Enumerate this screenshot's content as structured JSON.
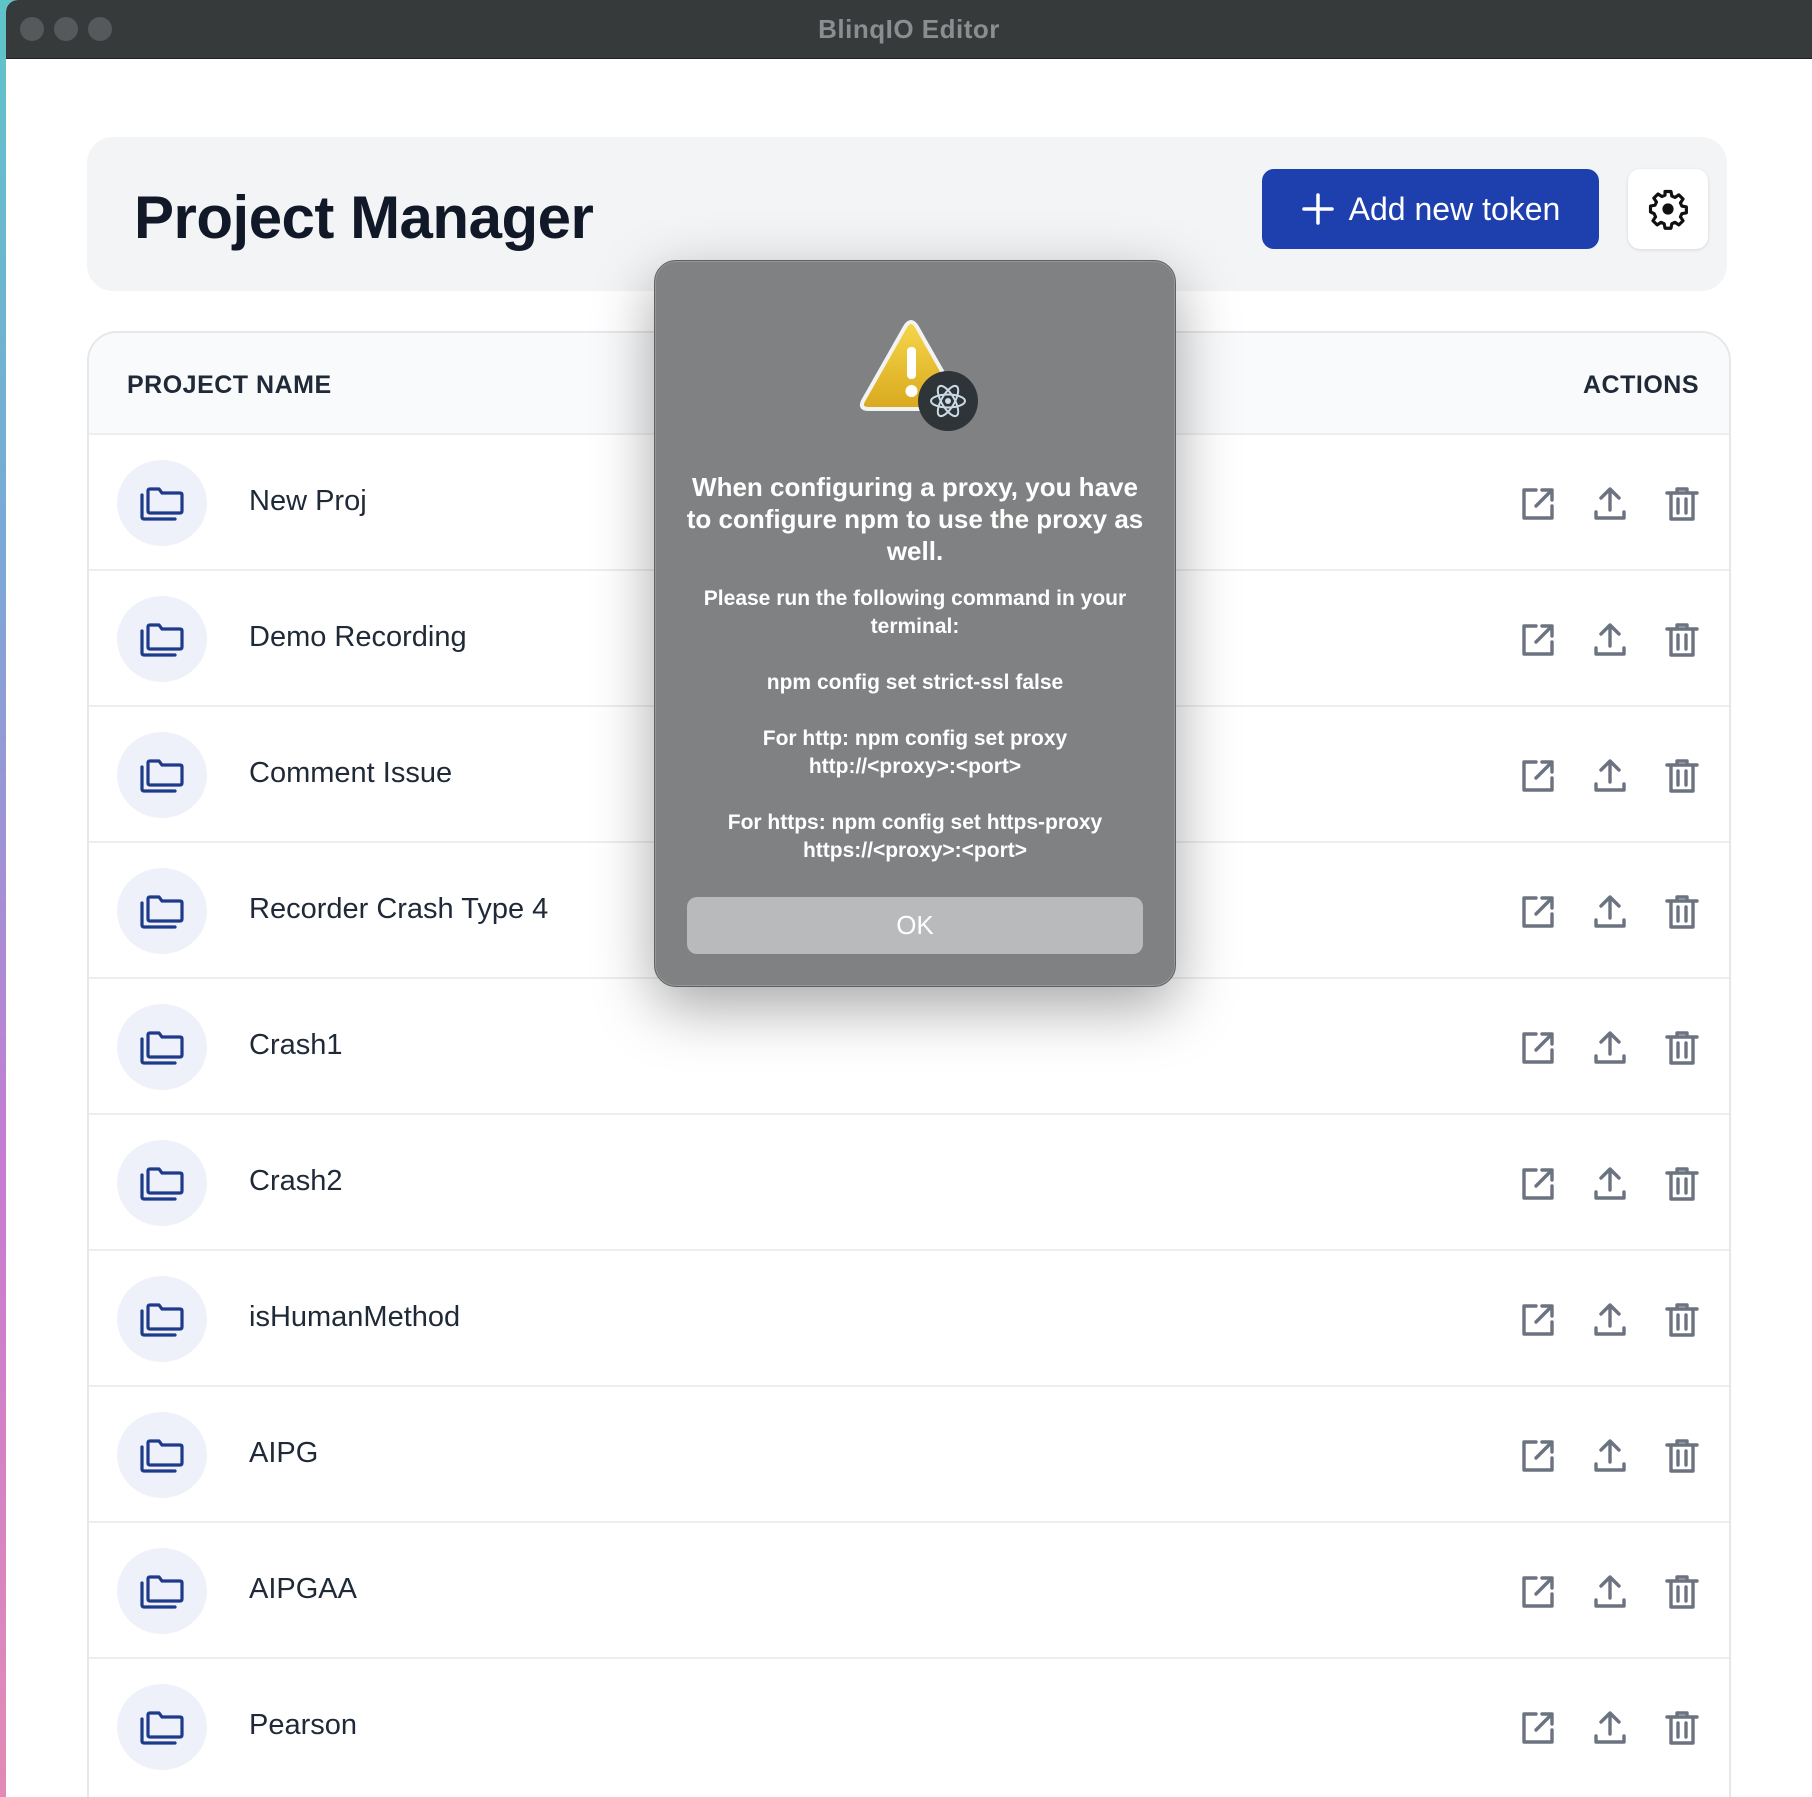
{
  "window": {
    "title": "BlinqIO Editor"
  },
  "header": {
    "title": "Project Manager",
    "add_token_label": "Add new token"
  },
  "table": {
    "columns": {
      "name": "PROJECT NAME",
      "actions": "ACTIONS"
    },
    "rows": [
      {
        "name": "New Proj"
      },
      {
        "name": "Demo Recording"
      },
      {
        "name": "Comment Issue"
      },
      {
        "name": "Recorder Crash Type 4"
      },
      {
        "name": "Crash1"
      },
      {
        "name": "Crash2"
      },
      {
        "name": "isHumanMethod"
      },
      {
        "name": "AIPG"
      },
      {
        "name": "AIPGAA"
      },
      {
        "name": "Pearson"
      }
    ]
  },
  "dialog": {
    "title": "When configuring a proxy, you have to configure npm to use the proxy as well.",
    "line1": "Please run the following command in your terminal:",
    "line2": "npm config set strict-ssl false",
    "line3": "For http: npm config set proxy http://<proxy>:<port>",
    "line4": "For https: npm config set https-proxy https://<proxy>:<port>",
    "ok_label": "OK"
  },
  "icons": {
    "folder": "folders-icon",
    "open": "external-link-icon",
    "upload": "upload-icon",
    "delete": "trash-icon",
    "settings": "gear-icon",
    "warning": "warning-icon",
    "app": "electron-icon",
    "add": "plus-icon"
  },
  "colors": {
    "primary": "#1e40af",
    "icon_blue": "#1e3a8a",
    "icon_gray": "#6b7280",
    "dialog_bg": "#7f8182"
  }
}
